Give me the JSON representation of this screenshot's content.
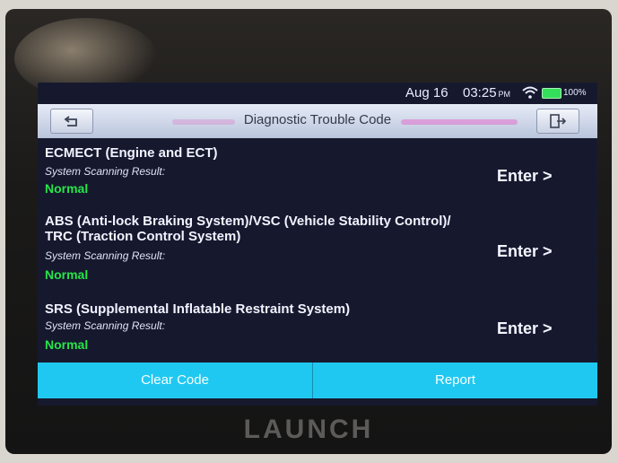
{
  "status_bar": {
    "date": "Aug 16",
    "time": "03:25",
    "ampm": "PM",
    "battery": "100%"
  },
  "header": {
    "title": "Diagnostic Trouble Code"
  },
  "systems": [
    {
      "name": "ECMECT (Engine and ECT)",
      "label": "System Scanning Result:",
      "status": "Normal",
      "enter": "Enter >"
    },
    {
      "name": "ABS (Anti-lock Braking System)/VSC (Vehicle Stability Control)/ TRC (Traction Control System)",
      "label": "System Scanning Result:",
      "status": "Normal",
      "enter": "Enter >"
    },
    {
      "name": "SRS (Supplemental Inflatable Restraint System)",
      "label": "System Scanning Result:",
      "status": "Normal",
      "enter": "Enter >"
    }
  ],
  "actions": {
    "clear": "Clear Code",
    "report": "Report"
  },
  "brand": "LAUNCH",
  "colors": {
    "status_ok": "#28e34a",
    "action_bar": "#1fc8f0",
    "screen_bg": "#16192e"
  }
}
